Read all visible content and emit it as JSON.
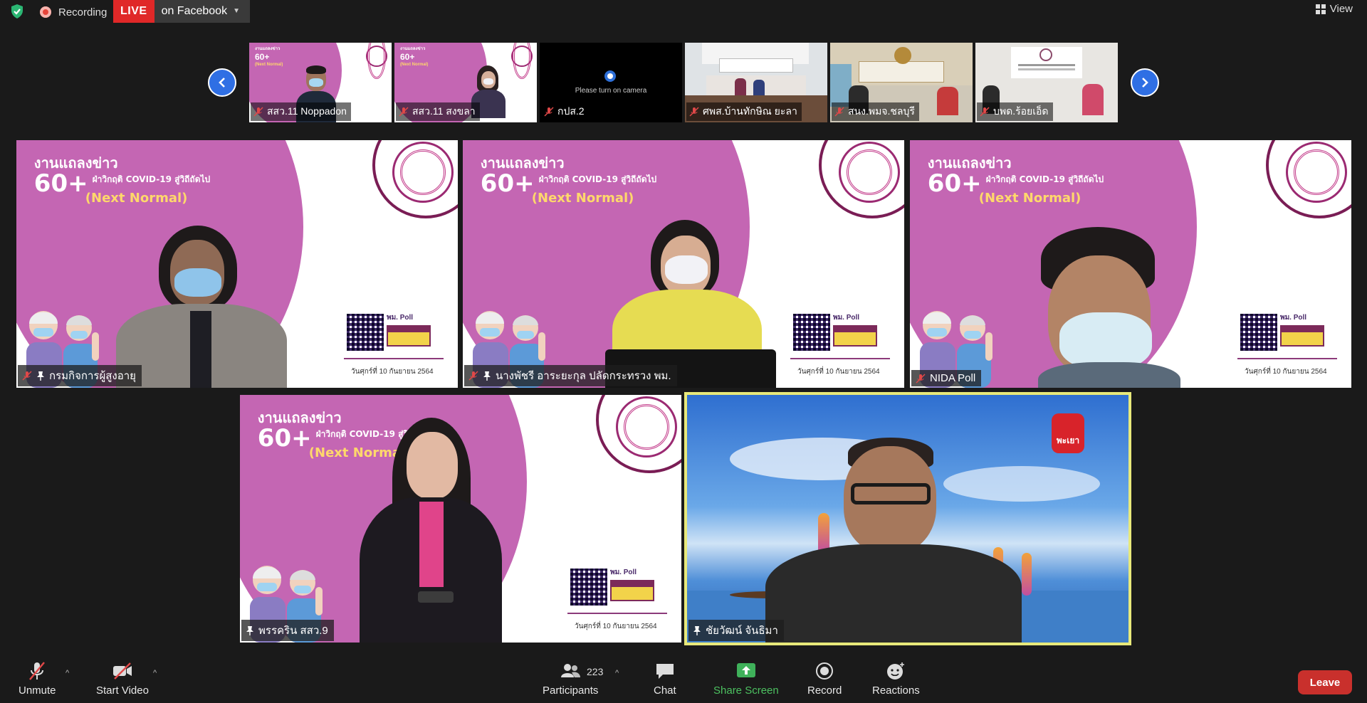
{
  "topbar": {
    "recording_label": "Recording",
    "live_label": "LIVE",
    "live_target": "on Facebook",
    "view_label": "View"
  },
  "banner": {
    "title_line1": "งานแถลงข่าว",
    "title_number": "60+",
    "title_sub": "ฝ่าวิกฤติ COVID-19 สู่วิถีถัดไป",
    "title_line3": "(Next Normal)",
    "date_text": "วันศุกร์ที่ 10 กันยายน 2564",
    "nida_text": "NIDA Poll",
    "poll_text": "พม. Poll"
  },
  "filmstrip": {
    "thumbs": [
      {
        "name": "สสว.11 Noppadon"
      },
      {
        "name": "สสว.11 สงขลา"
      },
      {
        "name": "กปส.2",
        "screen_text": "Please turn on camera"
      },
      {
        "name": "ศพส.บ้านทักษิณ ยะลา"
      },
      {
        "name": "สนง.พมจ.ชลบุรี"
      },
      {
        "name": "บพด.ร้อยเอ็ด"
      }
    ]
  },
  "tiles": [
    {
      "name": "กรมกิจการผู้สูงอายุ"
    },
    {
      "name": "นางพัชรี อาระยะกุล ปลัดกระทรวง พม."
    },
    {
      "name": "NIDA Poll"
    },
    {
      "name": "พรรคริน สสว.9"
    },
    {
      "name": "ชัยวัฒน์ จันธิมา",
      "tv_logo_text": "พะเยา"
    }
  ],
  "toolbar": {
    "unmute_label": "Unmute",
    "start_video_label": "Start Video",
    "participants_label": "Participants",
    "participants_count": "223",
    "chat_label": "Chat",
    "share_label": "Share Screen",
    "record_label": "Record",
    "reactions_label": "Reactions",
    "leave_label": "Leave"
  },
  "colors": {
    "live_red": "#e02828",
    "active_speaker_border": "#e8e97a",
    "share_green": "#4cc060",
    "leave_red": "#c9302c",
    "banner_pink": "#c466b3"
  }
}
